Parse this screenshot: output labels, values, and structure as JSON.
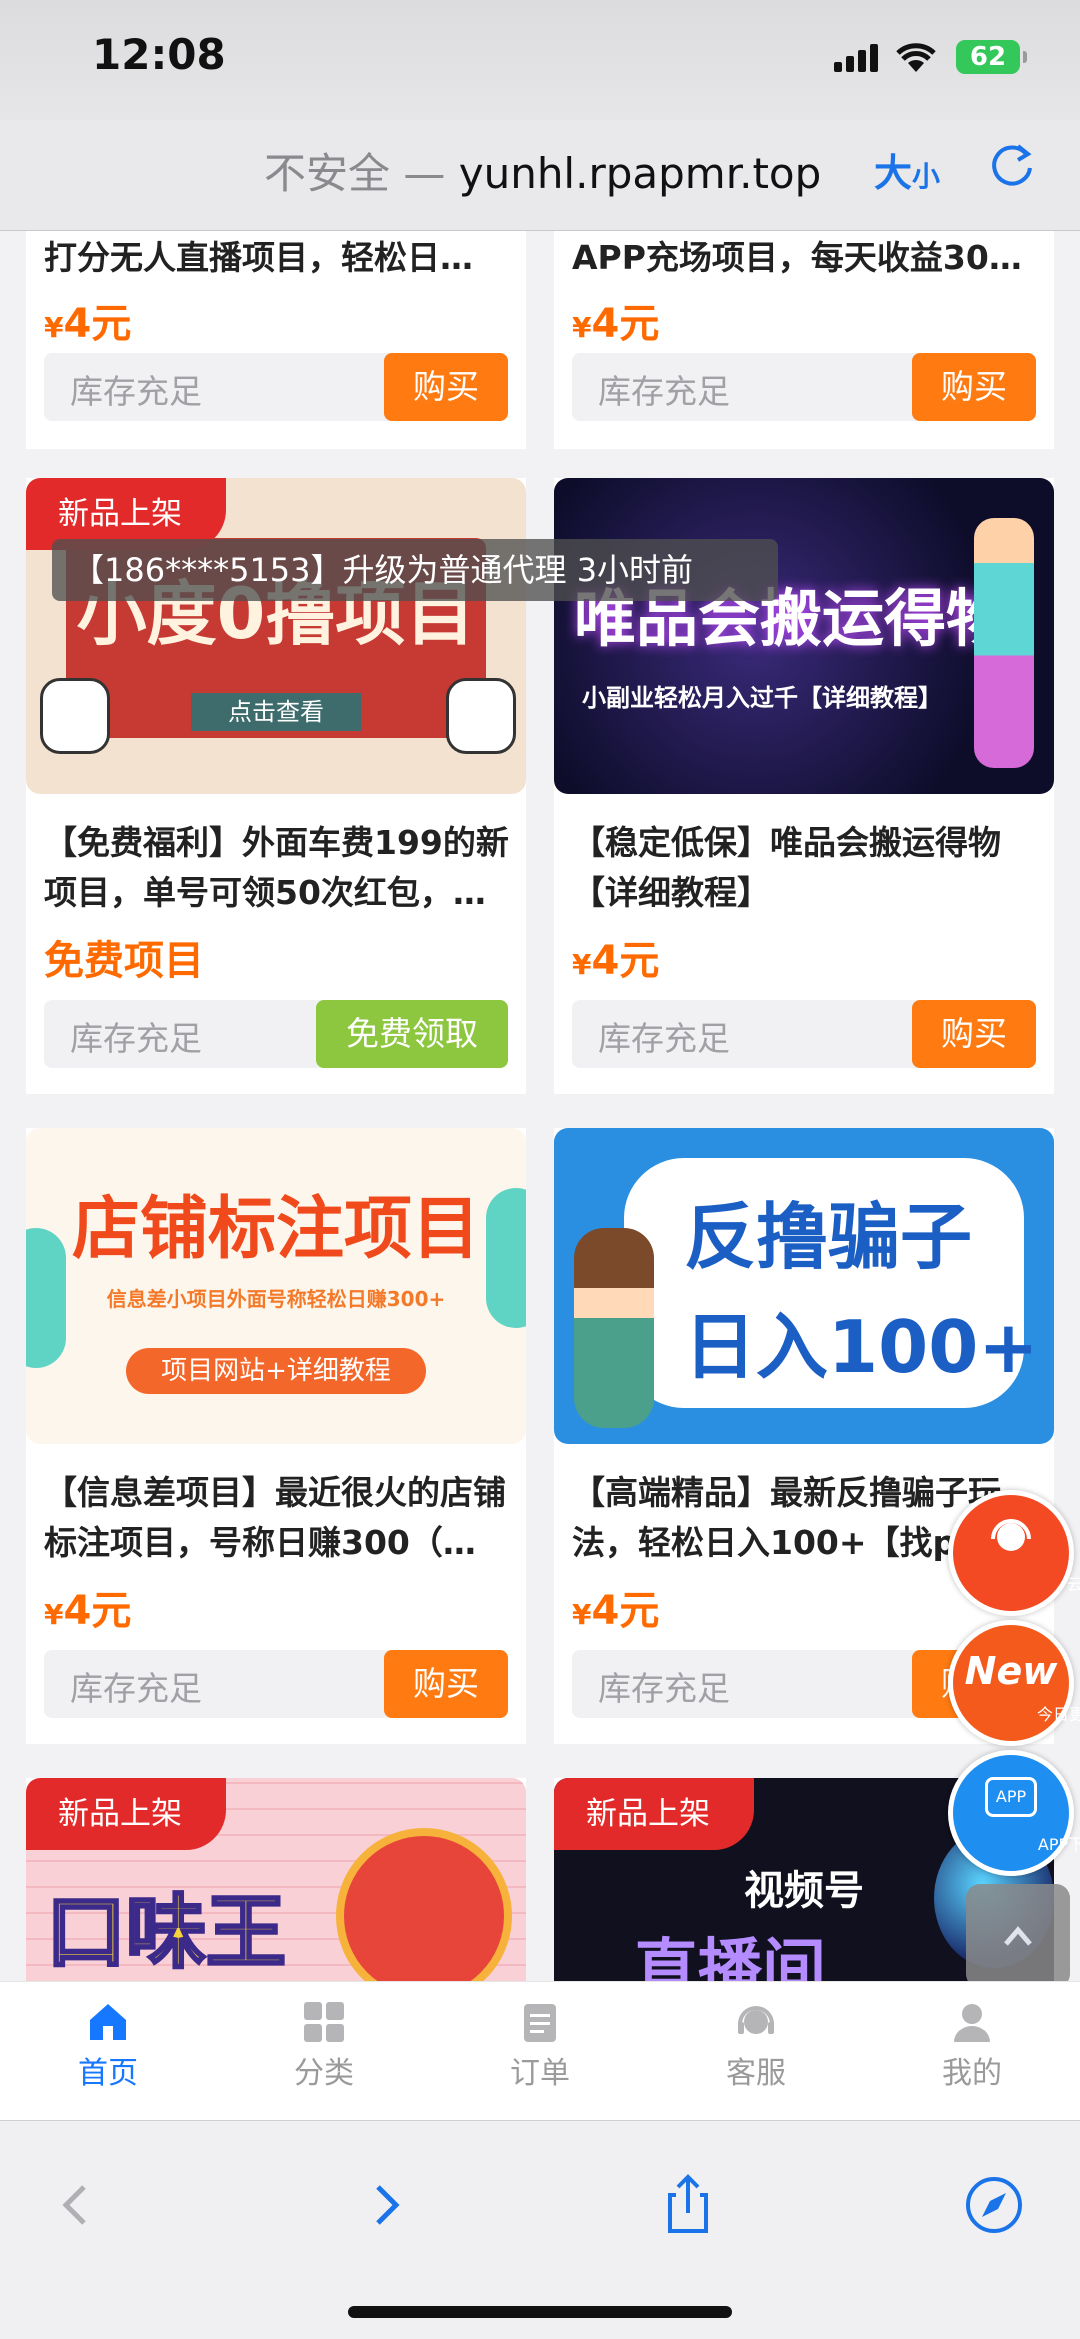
{
  "status": {
    "time": "12:08",
    "battery": "62"
  },
  "browser": {
    "insecure_label": "不安全",
    "separator": " — ",
    "domain": "yunhl.rpapmr.top",
    "text_size_big": "大",
    "text_size_small": "小"
  },
  "toast": "【186****5153】升级为普通代理 3小时前",
  "top_cards": [
    {
      "title": "打分无人直播项目，轻松日…",
      "price_symbol": "¥",
      "price": "4元",
      "stock": "库存充足",
      "button": "购买"
    },
    {
      "title": "APP充场项目，每天收益30…",
      "price_symbol": "¥",
      "price": "4元",
      "stock": "库存充足",
      "button": "购买"
    }
  ],
  "products": [
    {
      "tag": "新品上架",
      "image_title": "小度0撸项目",
      "image_sub": "点击查看",
      "title": "【免费福利】外面车费199的新项目，单号可领50次红包，…",
      "price": "免费项目",
      "stock": "库存充足",
      "button": "免费领取"
    },
    {
      "image_title": "唯品会搬运得物",
      "image_sub": "小副业轻松月入过千【详细教程】",
      "title": "【稳定低保】唯品会搬运得物【详细教程】",
      "price_symbol": "¥",
      "price": "4元",
      "stock": "库存充足",
      "button": "购买"
    },
    {
      "image_title": "店铺标注项目",
      "image_sub": "信息差小项目外面号称轻松日赚300+",
      "image_btn": "项目网站+详细教程",
      "title": "【信息差项目】最近很火的店铺标注项目，号称日赚300（…",
      "price_symbol": "¥",
      "price": "4元",
      "stock": "库存充足",
      "button": "购买"
    },
    {
      "image_title": "反撸骗子",
      "image_sub": "日入100+",
      "title": "【高端精品】最新反撸骗子玩法，轻松日入100+【找pz…",
      "price_symbol": "¥",
      "price": "4元",
      "stock": "库存充足",
      "button": "购买"
    },
    {
      "tag": "新品上架",
      "image_title": "口味王"
    },
    {
      "tag": "新品上架",
      "image_title": "视频号",
      "image_sub": "直播间"
    }
  ],
  "floating": {
    "robot": "云机器人",
    "new_badge": "New",
    "new": "今日更新",
    "app_badge": "APP",
    "app": "APP下载"
  },
  "tabs": [
    {
      "label": "首页",
      "icon": "home-icon",
      "active": true
    },
    {
      "label": "分类",
      "icon": "category-icon"
    },
    {
      "label": "订单",
      "icon": "order-icon"
    },
    {
      "label": "客服",
      "icon": "support-icon"
    },
    {
      "label": "我的",
      "icon": "profile-icon"
    }
  ],
  "colors": {
    "accent": "#ff7a11",
    "price": "#ff6a00",
    "free": "#8dc63f",
    "tab_active": "#1677ff",
    "tag": "#e32a2a"
  }
}
